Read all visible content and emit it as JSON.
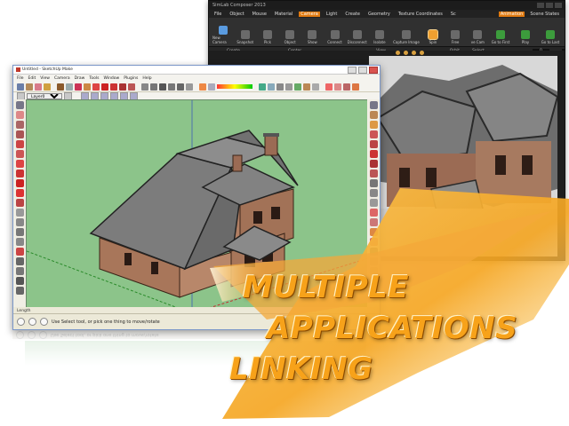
{
  "back_window": {
    "title": "SimLab Composer 2013",
    "menus": [
      "File",
      "Object",
      "Mouse",
      "Material",
      "Camera",
      "Light",
      "Create",
      "Geometry",
      "Texture Coordinates",
      "Sc"
    ],
    "active_menu": "Camera",
    "right_tabs": [
      "Animation",
      "Scene States"
    ],
    "tools": [
      "New Camera",
      "Snapshot",
      "Pick",
      "Object",
      "Show",
      "Connect",
      "Disconnect",
      "Isolate",
      "Capture Image",
      "Spin",
      "Free",
      "ve Cam"
    ],
    "groups": [
      "Create",
      "Center",
      "View",
      "Orbit",
      "Select"
    ],
    "anim_tools": [
      "Go to First",
      "Play",
      "Go to Last"
    ],
    "anim_fields": [
      "0",
      "100"
    ]
  },
  "front_window": {
    "title": "Untitled - SketchUp Make",
    "menus": [
      "File",
      "Edit",
      "View",
      "Camera",
      "Draw",
      "Tools",
      "Window",
      "Plugins",
      "Help"
    ],
    "layer_value": "Layer0",
    "measurements_label": "Length",
    "status_text": "Use Select tool, or pick one thing to move/rotate"
  },
  "tagline": {
    "line1": "MULTIPLE",
    "line2": "APPLICATIONS",
    "line3": "LINKING"
  },
  "colors": {
    "accent_orange": "#f7a21a",
    "viewport_green": "#8cc48a",
    "dark_ui": "#2a2a2a",
    "roof_gray": "#7c7c7c",
    "brick": "#a8765a"
  },
  "icons": [
    "minimize-icon",
    "maximize-icon",
    "close-icon",
    "camera-icon",
    "play-icon",
    "orbit-icon",
    "select-arrow-icon",
    "pencil-icon",
    "eraser-icon",
    "paint-bucket-icon",
    "circle-icon",
    "push-pull-icon",
    "move-icon",
    "tape-measure-icon",
    "zoom-icon",
    "pan-icon"
  ]
}
